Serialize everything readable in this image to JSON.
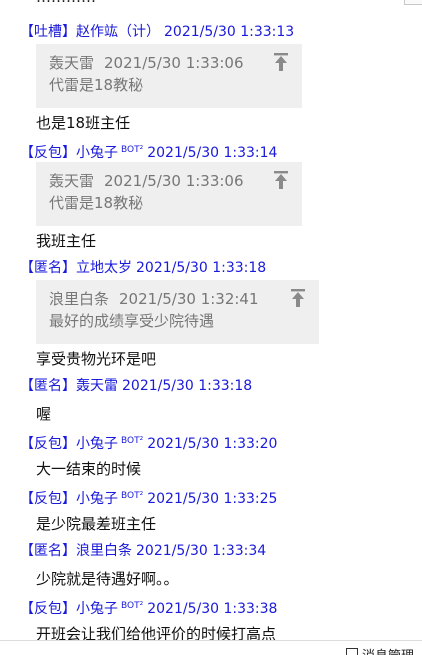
{
  "cutoff_top_text": "…………",
  "messages": [
    {
      "tag": "【吐槽】",
      "sender": "赵作竑（计）",
      "bot": "",
      "time": "2021/5/30 1:33:13",
      "quote": {
        "name": "轰天雷",
        "time": "2021/5/30 1:33:06",
        "text": "代雷是18教秘"
      },
      "text": "也是18班主任"
    },
    {
      "tag": "【反包】",
      "sender": "小兔子",
      "bot": "BOT²",
      "time": "2021/5/30 1:33:14",
      "quote": {
        "name": "轰天雷",
        "time": "2021/5/30 1:33:06",
        "text": "代雷是18教秘"
      },
      "text": "我班主任"
    },
    {
      "tag": "【匿名】",
      "sender": "立地太岁",
      "bot": "",
      "time": "2021/5/30 1:33:18",
      "quote": {
        "name": "浪里白条",
        "time": "2021/5/30 1:32:41",
        "text": "最好的成绩享受少院待遇"
      },
      "text": "享受贵物光环是吧"
    },
    {
      "tag": "【匿名】",
      "sender": "轰天雷",
      "bot": "",
      "time": "2021/5/30 1:33:18",
      "text": "喔"
    },
    {
      "tag": "【反包】",
      "sender": "小兔子",
      "bot": "BOT²",
      "time": "2021/5/30 1:33:20",
      "text": "大一结束的时候"
    },
    {
      "tag": "【反包】",
      "sender": "小兔子",
      "bot": "BOT²",
      "time": "2021/5/30 1:33:25",
      "text": "是少院最差班主任"
    },
    {
      "tag": "【匿名】",
      "sender": "浪里白条",
      "bot": "",
      "time": "2021/5/30 1:33:34",
      "text": "少院就是待遇好啊。。"
    },
    {
      "tag": "【反包】",
      "sender": "小兔子",
      "bot": "BOT²",
      "time": "2021/5/30 1:33:38",
      "text": "开班会让我们给他评价的时候打高点"
    }
  ],
  "footer": {
    "label": "消息管理"
  },
  "colors": {
    "header_blue": "#1a1adb",
    "quote_bg": "#efefef",
    "quote_text": "#777777",
    "message_text": "#111111"
  }
}
